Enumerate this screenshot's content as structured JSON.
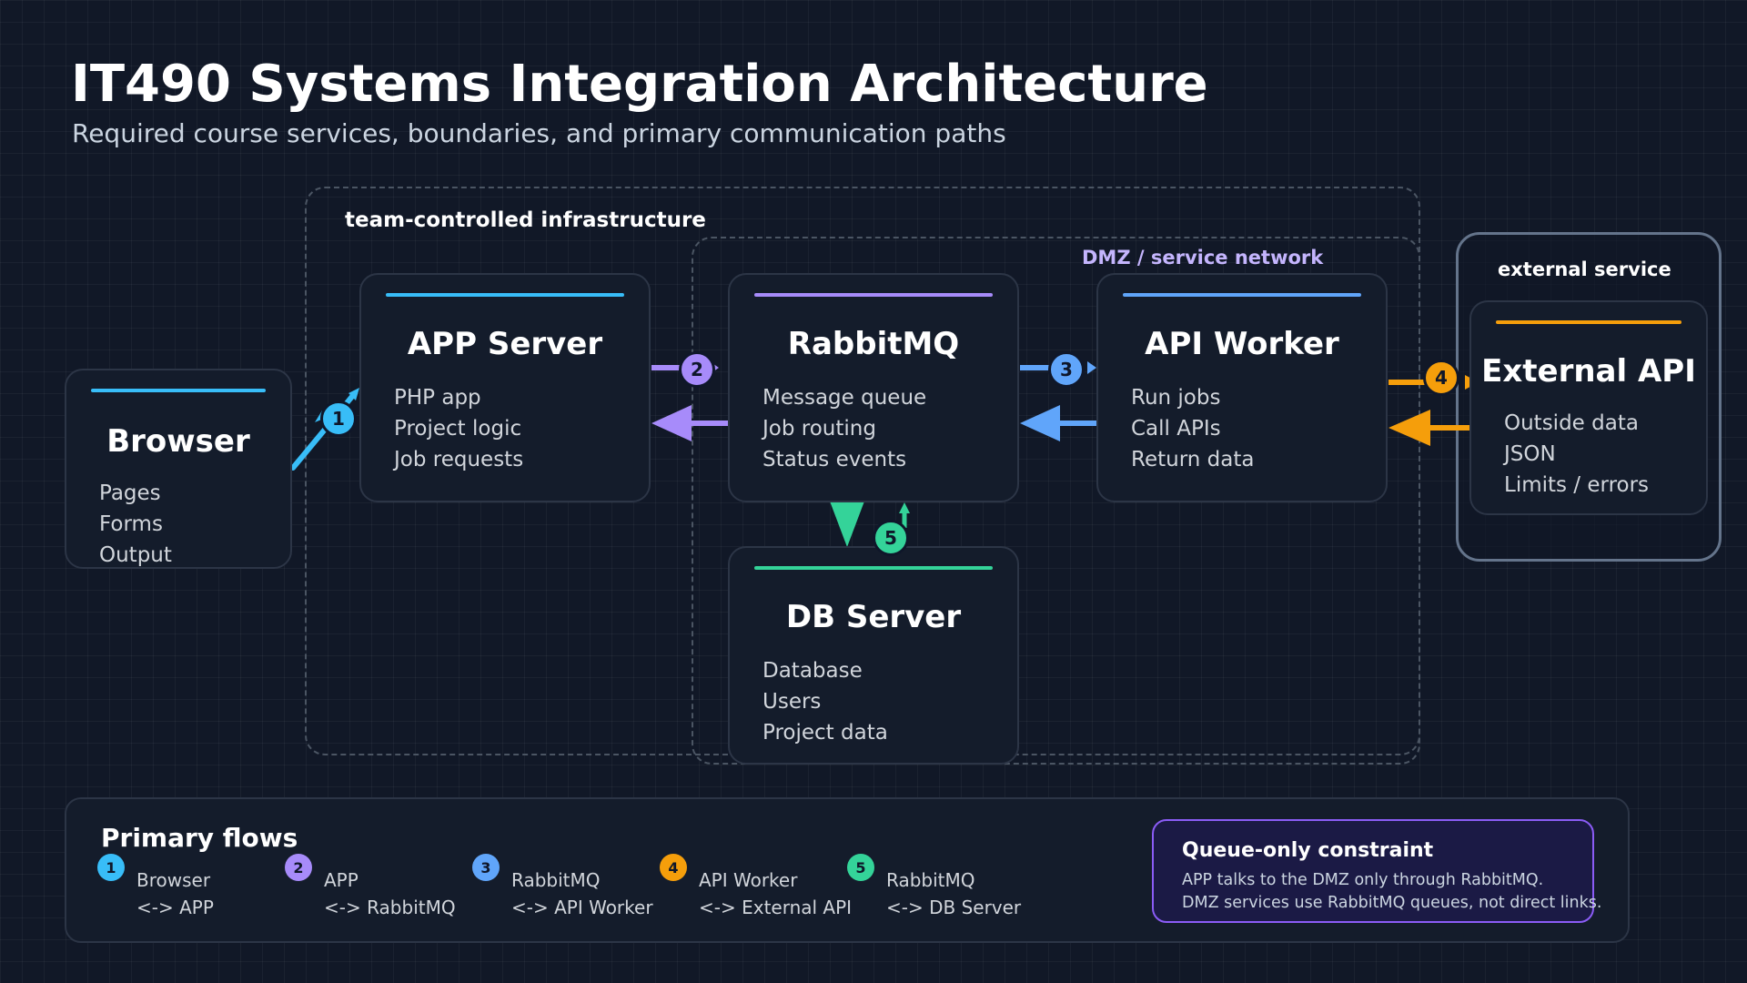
{
  "header": {
    "title": "IT490 Systems Integration Architecture",
    "subtitle": "Required course services, boundaries, and primary communication paths"
  },
  "zones": {
    "team": "team-controlled infrastructure",
    "dmz": "DMZ / service network",
    "external": "external service"
  },
  "nodes": {
    "browser": {
      "title": "Browser",
      "items": [
        "Pages",
        "Forms",
        "Output"
      ],
      "accent": "#38bdf8"
    },
    "app": {
      "title": "APP Server",
      "items": [
        "PHP app",
        "Project logic",
        "Job requests"
      ],
      "accent": "#38bdf8"
    },
    "rabbit": {
      "title": "RabbitMQ",
      "items": [
        "Message queue",
        "Job routing",
        "Status events"
      ],
      "accent": "#a78bfa"
    },
    "worker": {
      "title": "API Worker",
      "items": [
        "Run jobs",
        "Call APIs",
        "Return data"
      ],
      "accent": "#60a5fa"
    },
    "external": {
      "title": "External API",
      "items": [
        "Outside data",
        "JSON",
        "Limits / errors"
      ],
      "accent": "#f59e0b"
    },
    "db": {
      "title": "DB Server",
      "items": [
        "Database",
        "Users",
        "Project data"
      ],
      "accent": "#34d399"
    }
  },
  "flows": [
    {
      "n": "1",
      "color": "#38bdf8",
      "line1": "Browser",
      "line2": "<-> APP"
    },
    {
      "n": "2",
      "color": "#a78bfa",
      "line1": "APP",
      "line2": "<-> RabbitMQ"
    },
    {
      "n": "3",
      "color": "#60a5fa",
      "line1": "RabbitMQ",
      "line2": "<-> API Worker"
    },
    {
      "n": "4",
      "color": "#f59e0b",
      "line1": "API Worker",
      "line2": "<-> External API"
    },
    {
      "n": "5",
      "color": "#34d399",
      "line1": "RabbitMQ",
      "line2": "<-> DB Server"
    }
  ],
  "legend": {
    "title": "Primary flows"
  },
  "constraint": {
    "title": "Queue-only constraint",
    "line1": "APP talks to the DMZ only through RabbitMQ.",
    "line2": "DMZ services use RabbitMQ queues, not direct links."
  }
}
